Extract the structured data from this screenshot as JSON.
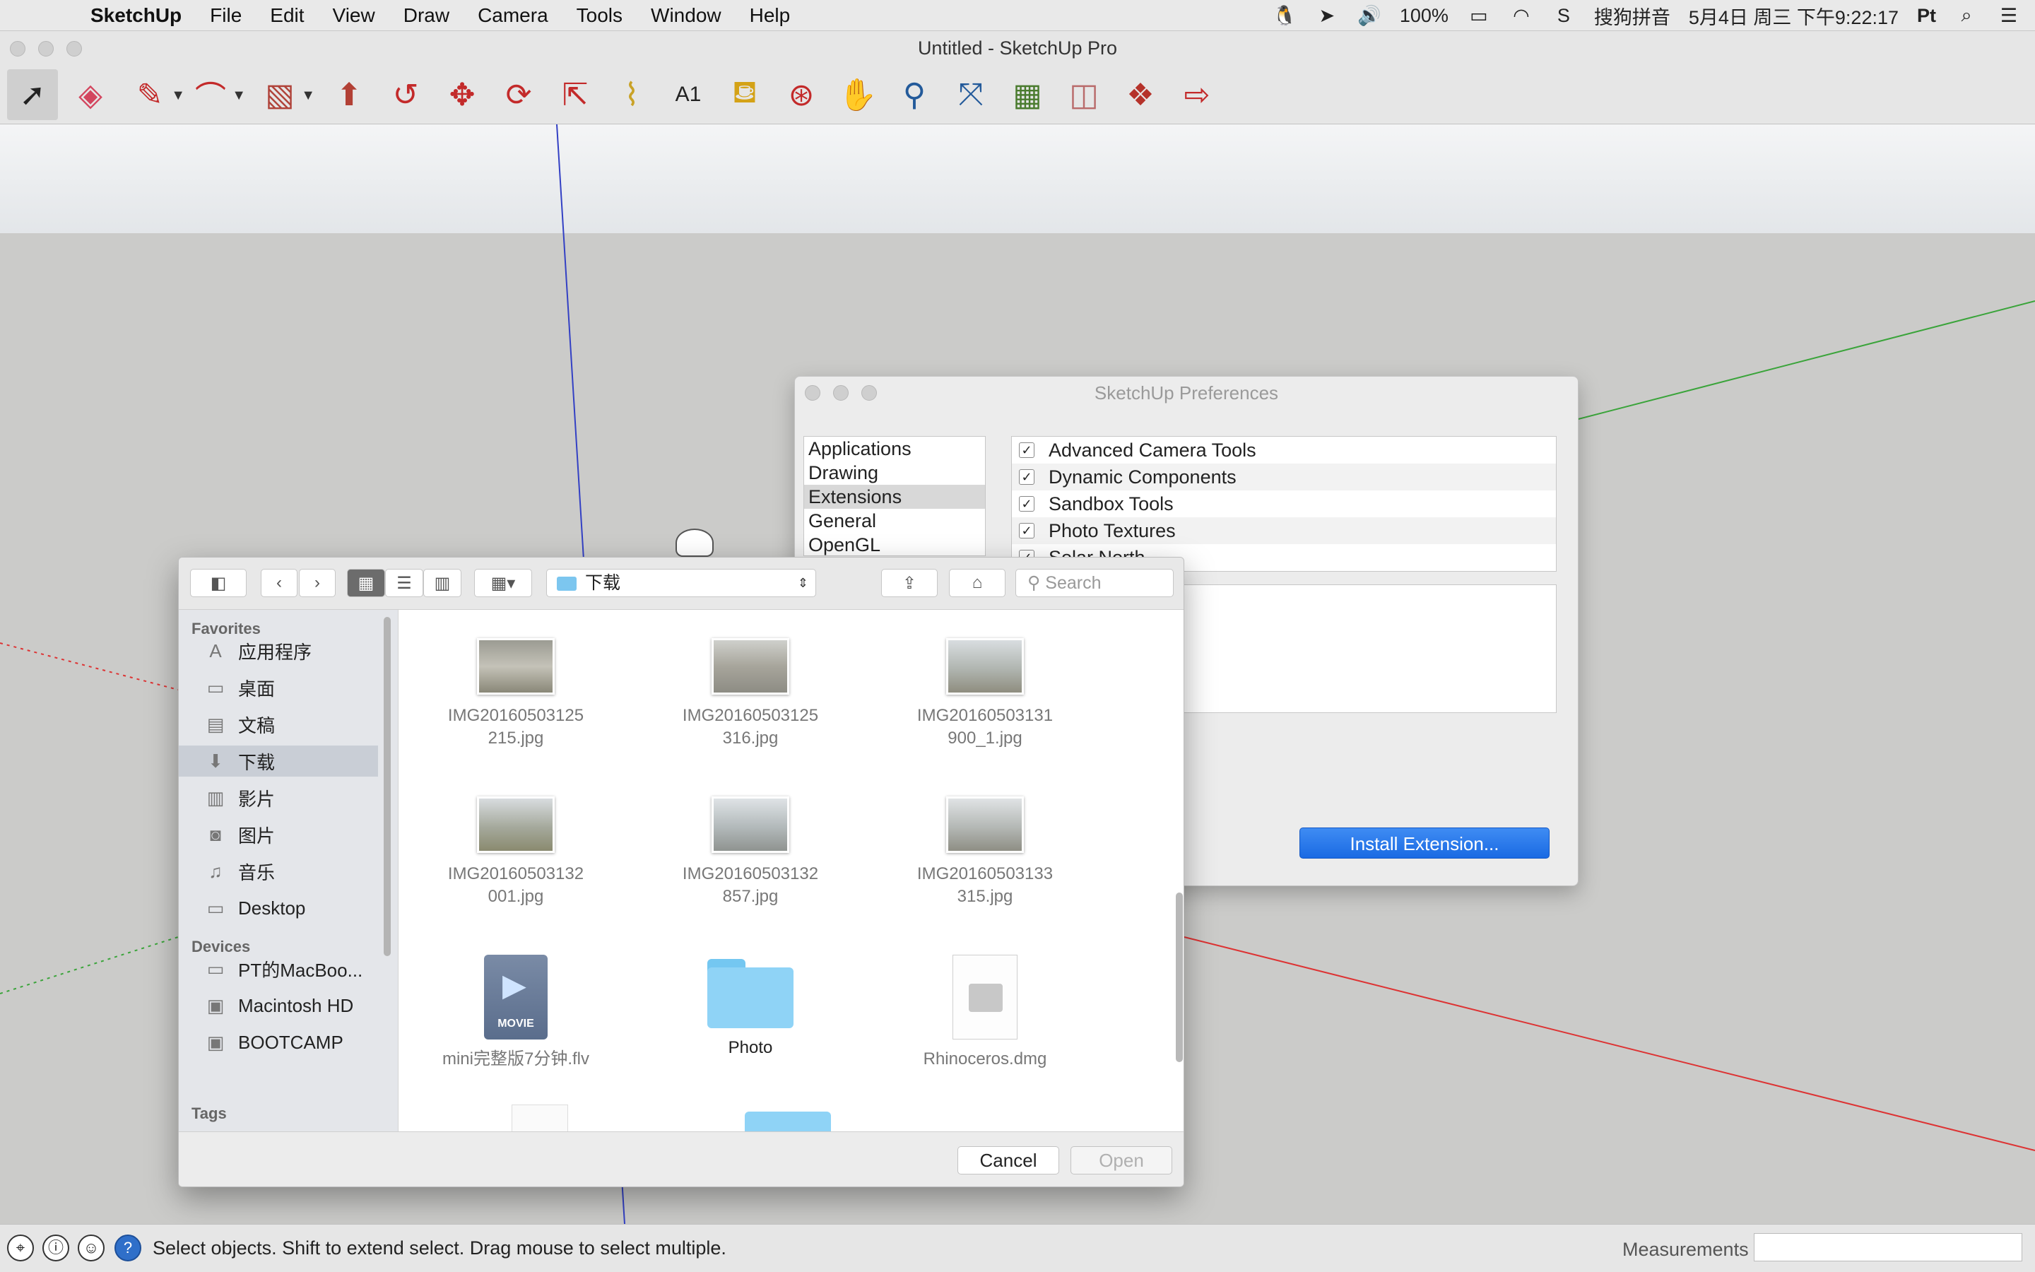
{
  "menubar": {
    "items": [
      "SketchUp",
      "File",
      "Edit",
      "View",
      "Draw",
      "Camera",
      "Tools",
      "Window",
      "Help"
    ],
    "battery": "100%",
    "input_method": "搜狗拼音",
    "datetime": "5月4日 周三 下午9:22:17",
    "user": "Pt"
  },
  "window": {
    "title": "Untitled - SketchUp Pro"
  },
  "toolbar": {
    "tools": [
      "select",
      "eraser",
      "pencil",
      "arc",
      "rectangle",
      "push-pull",
      "follow-me",
      "move",
      "rotate",
      "scale",
      "tape-measure",
      "text",
      "paint-bucket",
      "orbit",
      "pan",
      "zoom",
      "zoom-extents",
      "get-models",
      "photo-textures",
      "3d-warehouse",
      "extension-warehouse"
    ]
  },
  "preferences": {
    "title": "SketchUp Preferences",
    "categories": [
      "Applications",
      "Drawing",
      "Extensions",
      "General",
      "OpenGL"
    ],
    "selected_category": "Extensions",
    "extensions": [
      {
        "label": "Advanced Camera Tools",
        "checked": true
      },
      {
        "label": "Dynamic Components",
        "checked": true
      },
      {
        "label": "Sandbox Tools",
        "checked": true
      },
      {
        "label": "Photo Textures",
        "checked": true
      },
      {
        "label": "Solar North",
        "checked": true
      }
    ],
    "install_label": "Install Extension..."
  },
  "file_dialog": {
    "location": "下载",
    "search_placeholder": "Search",
    "favorites_heading": "Favorites",
    "favorites": [
      "应用程序",
      "桌面",
      "文稿",
      "下载",
      "影片",
      "图片",
      "音乐",
      "Desktop"
    ],
    "selected_favorite": "下载",
    "devices_heading": "Devices",
    "devices": [
      "PT的MacBoo...",
      "Macintosh HD",
      "BOOTCAMP"
    ],
    "tags_heading": "Tags",
    "files": [
      {
        "line1": "IMG20160503125",
        "line2": "215.jpg"
      },
      {
        "line1": "IMG20160503125",
        "line2": "316.jpg"
      },
      {
        "line1": "IMG20160503131",
        "line2": "900_1.jpg"
      },
      {
        "line1": "IMG20160503132",
        "line2": "001.jpg"
      },
      {
        "line1": "IMG20160503132",
        "line2": "857.jpg"
      },
      {
        "line1": "IMG20160503133",
        "line2": "315.jpg"
      },
      {
        "line1": "mini完整版7分钟.flv",
        "line2": ""
      },
      {
        "line1": "Photo",
        "line2": ""
      },
      {
        "line1": "Rhinoceros.dmg",
        "line2": ""
      }
    ],
    "movie_badge": "MOVIE",
    "cancel_label": "Cancel",
    "open_label": "Open"
  },
  "statusbar": {
    "message": "Select objects. Shift to extend select. Drag mouse to select multiple.",
    "measurements_label": "Measurements"
  }
}
